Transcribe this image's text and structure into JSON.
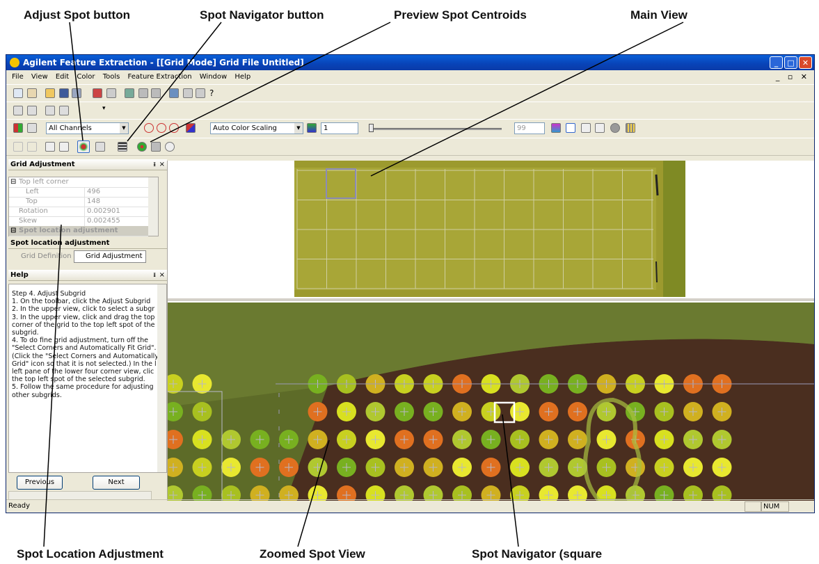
{
  "callouts": {
    "adjust_spot_button": "Adjust Spot button",
    "spot_navigator_button": "Spot Navigator button",
    "preview_spot_centroids": "Preview Spot Centroids",
    "main_view": "Main View",
    "spot_location_adjustment": "Spot Location Adjustment",
    "zoomed_spot_view": "Zoomed Spot View",
    "spot_navigator_square": "Spot Navigator (square"
  },
  "window": {
    "title": "Agilent Feature Extraction - [[Grid Mode] Grid File Untitled]",
    "menu": [
      "File",
      "View",
      "Edit",
      "Color",
      "Tools",
      "Feature Extraction",
      "Window",
      "Help"
    ]
  },
  "toolbar": {
    "channel_select": "All Channels",
    "color_scaling_select": "Auto Color Scaling",
    "scale_value": "1",
    "max_value": "99"
  },
  "grid_adjustment": {
    "title": "Grid Adjustment",
    "rows": [
      {
        "key": "Top left corner",
        "value": ""
      },
      {
        "key": "Left",
        "value": "496"
      },
      {
        "key": "Top",
        "value": "148"
      },
      {
        "key": "Rotation",
        "value": "0.002901"
      },
      {
        "key": "Skew",
        "value": "0.002455"
      },
      {
        "key": "Spot location adjustment",
        "value": ""
      }
    ],
    "description_title": "Spot location adjustment",
    "tabs": [
      "Grid Definition",
      "Grid Adjustment"
    ]
  },
  "help": {
    "title": "Help",
    "lines": [
      "Step 4. Adjust Subgrid",
      "  1. On the toolbar, click the Adjust Subgrid",
      "  2. In the upper view, click to select a subgr",
      "  3. In the upper view, click and drag the top",
      "corner of the grid to the top left spot of the",
      "subgrid.",
      "  4. To do fine grid adjustment, turn off the",
      "\"Select Corners and Automatically Fit Grid\".",
      "(Click the \"Select Corners and Automatically",
      "Grid\" icon so that it is not selected.) In the l",
      "left pane of the lower four corner view, clic",
      "the top left spot of the selected subgrid.",
      "  5. Follow the same procedure for adjusting",
      "other subgrids."
    ],
    "previous": "Previous",
    "next": "Next"
  },
  "status": {
    "text": "Ready",
    "num": "NUM"
  },
  "colors": {
    "titlebar": "#0843b7",
    "chrome": "#ece9d8",
    "chip": "#8a8a2a",
    "navigator": "#ffffff"
  }
}
